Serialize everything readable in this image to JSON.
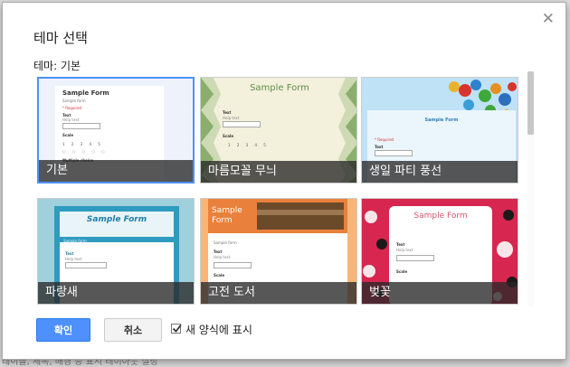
{
  "dialog": {
    "title": "테마 선택",
    "current_theme": "테마: 기본",
    "close_symbol": "✕",
    "ok_label": "확인",
    "cancel_label": "취소",
    "checkbox_label": "새 양식에 표시",
    "checkbox_checked": true
  },
  "themes": [
    {
      "name": "기본",
      "selected": true
    },
    {
      "name": "마름모꼴 무늬",
      "selected": false
    },
    {
      "name": "생일 파티 풍선",
      "selected": false
    },
    {
      "name": "파랑새",
      "selected": false
    },
    {
      "name": "고전 도서",
      "selected": false
    },
    {
      "name": "벚꽃",
      "selected": false
    }
  ],
  "preview": {
    "sample_form_title": "Sample Form",
    "help_text": "Help text",
    "required": "* Required",
    "text_label": "Text",
    "scale_label": "Scale",
    "multiple_choice_label": "Multiple choice",
    "sample_form_small": "Sample form"
  },
  "background_text": "레이블, 제목, 배경 등 표시 레이아웃 설정"
}
